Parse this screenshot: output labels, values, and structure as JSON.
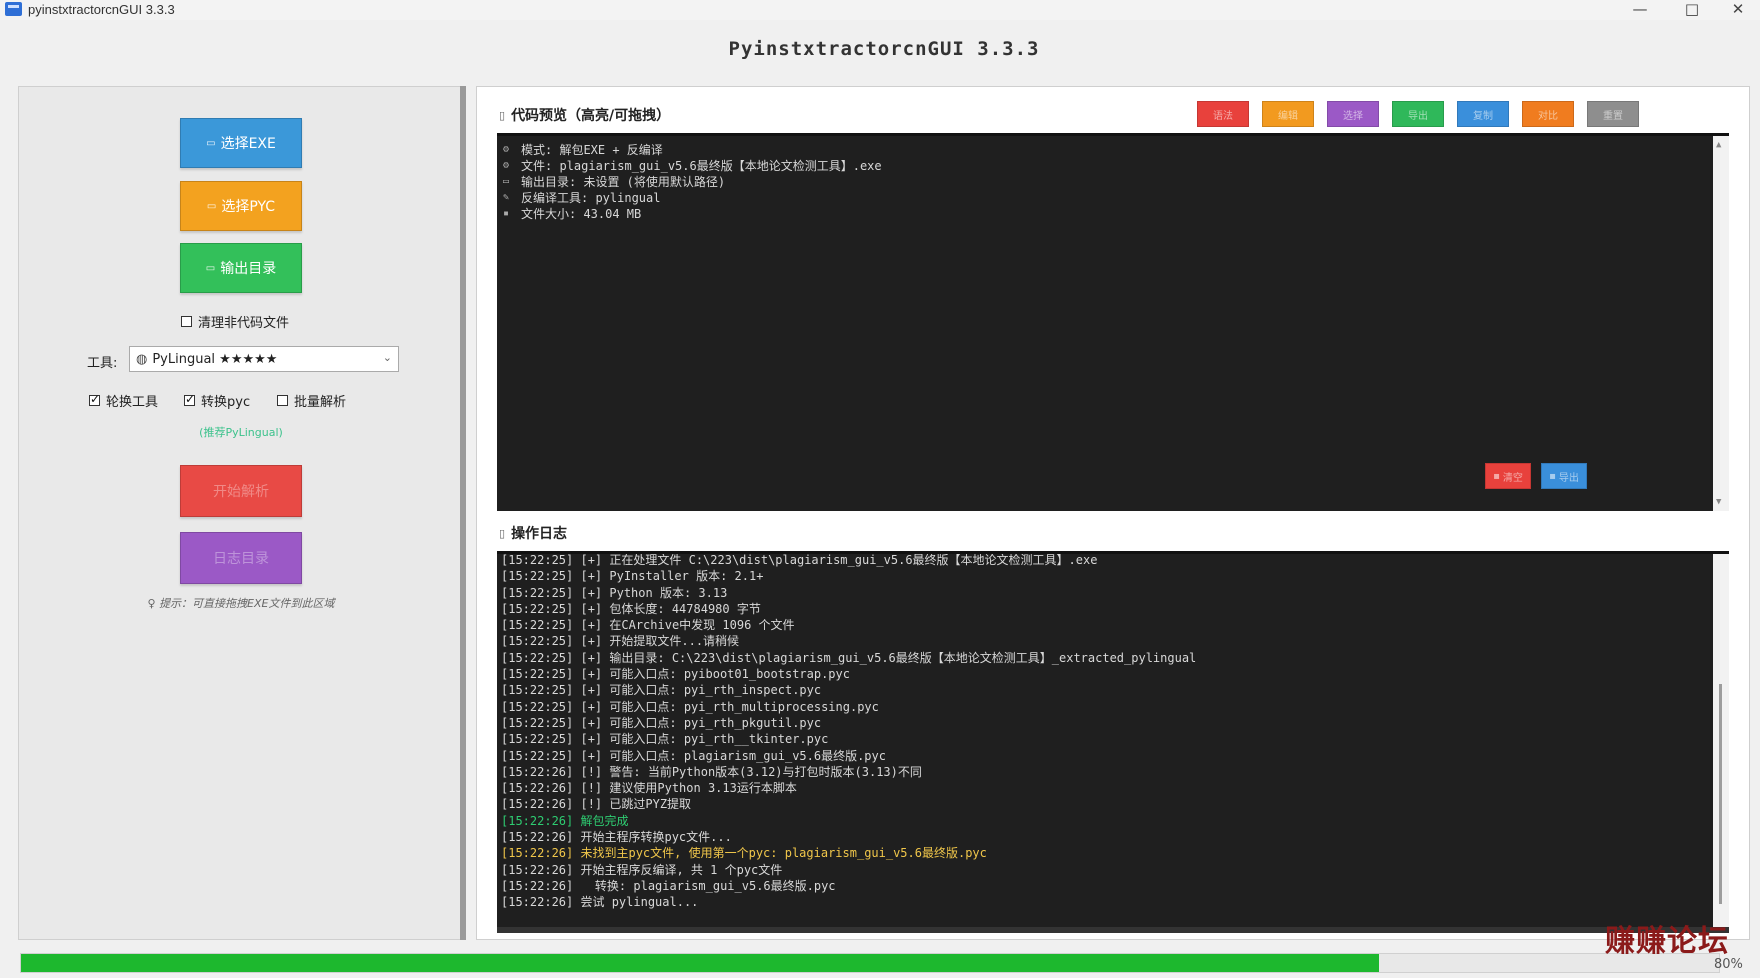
{
  "window": {
    "title": "pyinstxtractorcnGUI 3.3.3",
    "minimize": "—",
    "maximize": "□",
    "close": "✕"
  },
  "app_heading": "PyinstxtractorcnGUI 3.3.3",
  "left": {
    "select_exe": "选择EXE",
    "select_pyc": "选择PYC",
    "output_dir": "输出目录",
    "clean_label": "清理非代码文件",
    "clean_checked": false,
    "tool_label": "工具:",
    "tool_value": "PyLingual ★★★★★",
    "rotate_label": "轮换工具",
    "rotate_checked": true,
    "convert_label": "转换pyc",
    "convert_checked": true,
    "batch_label": "批量解析",
    "batch_checked": false,
    "recommend": "(推荐PyLingual)",
    "start_button": "开始解析",
    "log_button": "日志目录",
    "hint": "提示：可直接拖拽EXE文件到此区域"
  },
  "preview": {
    "title": "代码预览（高亮/可拖拽）",
    "toolbar": [
      {
        "label": "语法",
        "color": "#e8413c"
      },
      {
        "label": "编辑",
        "color": "#f29a1f"
      },
      {
        "label": "选择",
        "color": "#9b59c6"
      },
      {
        "label": "导出",
        "color": "#2fb85a"
      },
      {
        "label": "复制",
        "color": "#3a8fdb"
      },
      {
        "label": "对比",
        "color": "#f07c1f"
      },
      {
        "label": "重置",
        "color": "#8e8e8e"
      }
    ],
    "lines": [
      "模式: 解包EXE + 反编译",
      "文件: plagiarism_gui_v5.6最终版【本地论文检测工具】.exe",
      "输出目录: 未设置 (将使用默认路径)",
      "反编译工具: pylingual",
      "文件大小: 43.04 MB"
    ],
    "line_icons": [
      "⚙",
      "⚙",
      "▭",
      "✎",
      "▪"
    ]
  },
  "log": {
    "title": "操作日志",
    "clear_label": "清空",
    "clear_color": "#e8413c",
    "export_label": "导出",
    "export_color": "#3a8fdb",
    "lines": [
      {
        "t": "[15:22:25] [+] 正在处理文件 C:\\223\\dist\\plagiarism_gui_v5.6最终版【本地论文检测工具】.exe",
        "c": ""
      },
      {
        "t": "[15:22:25] [+] PyInstaller 版本: 2.1+",
        "c": ""
      },
      {
        "t": "[15:22:25] [+] Python 版本: 3.13",
        "c": ""
      },
      {
        "t": "[15:22:25] [+] 包体长度: 44784980 字节",
        "c": ""
      },
      {
        "t": "[15:22:25] [+] 在CArchive中发现 1096 个文件",
        "c": ""
      },
      {
        "t": "[15:22:25] [+] 开始提取文件...请稍候",
        "c": ""
      },
      {
        "t": "[15:22:25] [+] 输出目录: C:\\223\\dist\\plagiarism_gui_v5.6最终版【本地论文检测工具】_extracted_pylingual",
        "c": ""
      },
      {
        "t": "[15:22:25] [+] 可能入口点: pyiboot01_bootstrap.pyc",
        "c": ""
      },
      {
        "t": "[15:22:25] [+] 可能入口点: pyi_rth_inspect.pyc",
        "c": ""
      },
      {
        "t": "[15:22:25] [+] 可能入口点: pyi_rth_multiprocessing.pyc",
        "c": ""
      },
      {
        "t": "[15:22:25] [+] 可能入口点: pyi_rth_pkgutil.pyc",
        "c": ""
      },
      {
        "t": "[15:22:25] [+] 可能入口点: pyi_rth__tkinter.pyc",
        "c": ""
      },
      {
        "t": "[15:22:25] [+] 可能入口点: plagiarism_gui_v5.6最终版.pyc",
        "c": ""
      },
      {
        "t": "[15:22:26] [!] 警告: 当前Python版本(3.12)与打包时版本(3.13)不同",
        "c": ""
      },
      {
        "t": "[15:22:26] [!] 建议使用Python 3.13运行本脚本",
        "c": ""
      },
      {
        "t": "[15:22:26] [!] 已跳过PYZ提取",
        "c": ""
      },
      {
        "t": "[15:22:26] 解包完成",
        "c": "green"
      },
      {
        "t": "[15:22:26] 开始主程序转换pyc文件...",
        "c": ""
      },
      {
        "t": "[15:22:26] 未找到主pyc文件, 使用第一个pyc: plagiarism_gui_v5.6最终版.pyc",
        "c": "yellow"
      },
      {
        "t": "[15:22:26] 开始主程序反编译, 共 1 个pyc文件",
        "c": ""
      },
      {
        "t": "[15:22:26]   转换: plagiarism_gui_v5.6最终版.pyc",
        "c": ""
      },
      {
        "t": "[15:22:26] 尝试 pylingual...",
        "c": ""
      }
    ]
  },
  "progress": {
    "value": 0.8,
    "label": "80%",
    "color": "#1db82e"
  },
  "watermark": "赚赚论坛"
}
